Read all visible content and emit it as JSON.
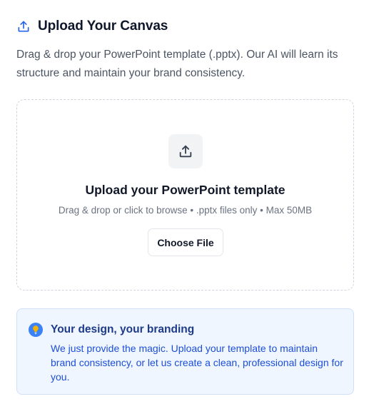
{
  "header": {
    "icon": "upload-icon",
    "title": "Upload Your Canvas"
  },
  "description": "Drag & drop your PowerPoint template (.pptx). Our AI will learn its structure and maintain your brand consistency.",
  "dropzone": {
    "icon": "upload-icon",
    "title": "Upload your PowerPoint template",
    "subtitle": "Drag & drop or click to browse • .pptx files only • Max 50MB",
    "button_label": "Choose File"
  },
  "info": {
    "icon": "lightbulb-icon",
    "title": "Your design, your branding",
    "text": "We just provide the magic. Upload your template to maintain brand consistency, or let us create a clean, professional design for you."
  },
  "colors": {
    "title_text": "#0f172a",
    "info_background": "#eff6ff",
    "info_title": "#1e3a8a",
    "info_text": "#1d4ed8",
    "info_icon": "#3b82f6",
    "info_icon_bulb": "#f5b301"
  }
}
